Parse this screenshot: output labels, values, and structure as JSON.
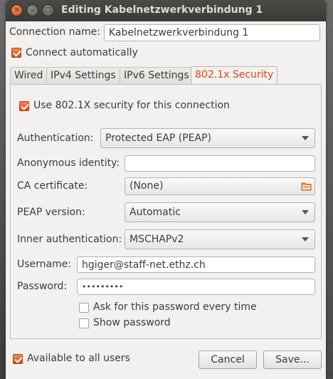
{
  "window": {
    "title": "Editing Kabelnetzwerkverbindung 1"
  },
  "connection_name": {
    "label": "Connection name:",
    "value": "Kabelnetzwerkverbindung 1"
  },
  "connect_automatically": {
    "label": "Connect automatically",
    "checked": true
  },
  "tabs": [
    {
      "label": "Wired",
      "active": false
    },
    {
      "label": "IPv4 Settings",
      "active": false
    },
    {
      "label": "IPv6 Settings",
      "active": false
    },
    {
      "label": "802.1x Security",
      "active": true
    }
  ],
  "security": {
    "use_8021x": {
      "label": "Use 802.1X security for this connection",
      "checked": true
    },
    "authentication": {
      "label": "Authentication:",
      "value": "Protected EAP (PEAP)"
    },
    "anonymous_identity": {
      "label": "Anonymous identity:",
      "value": ""
    },
    "ca_certificate": {
      "label": "CA certificate:",
      "value": "(None)",
      "icon": "folder-icon"
    },
    "peap_version": {
      "label": "PEAP version:",
      "value": "Automatic"
    },
    "inner_authentication": {
      "label": "Inner authentication:",
      "value": "MSCHAPv2"
    },
    "username": {
      "label": "Username:",
      "value": "hgiger@staff-net.ethz.ch"
    },
    "password": {
      "label": "Password:",
      "value": "•••••••••"
    },
    "ask_password": {
      "label": "Ask for this password every time",
      "checked": false
    },
    "show_password": {
      "label": "Show password",
      "checked": false
    }
  },
  "available_to_all": {
    "label": "Available to all users",
    "checked": true
  },
  "buttons": {
    "cancel": "Cancel",
    "save": "Save..."
  },
  "colors": {
    "accent": "#dd4814",
    "titlebar": "#3c3b37",
    "background": "#f2f1f0"
  }
}
